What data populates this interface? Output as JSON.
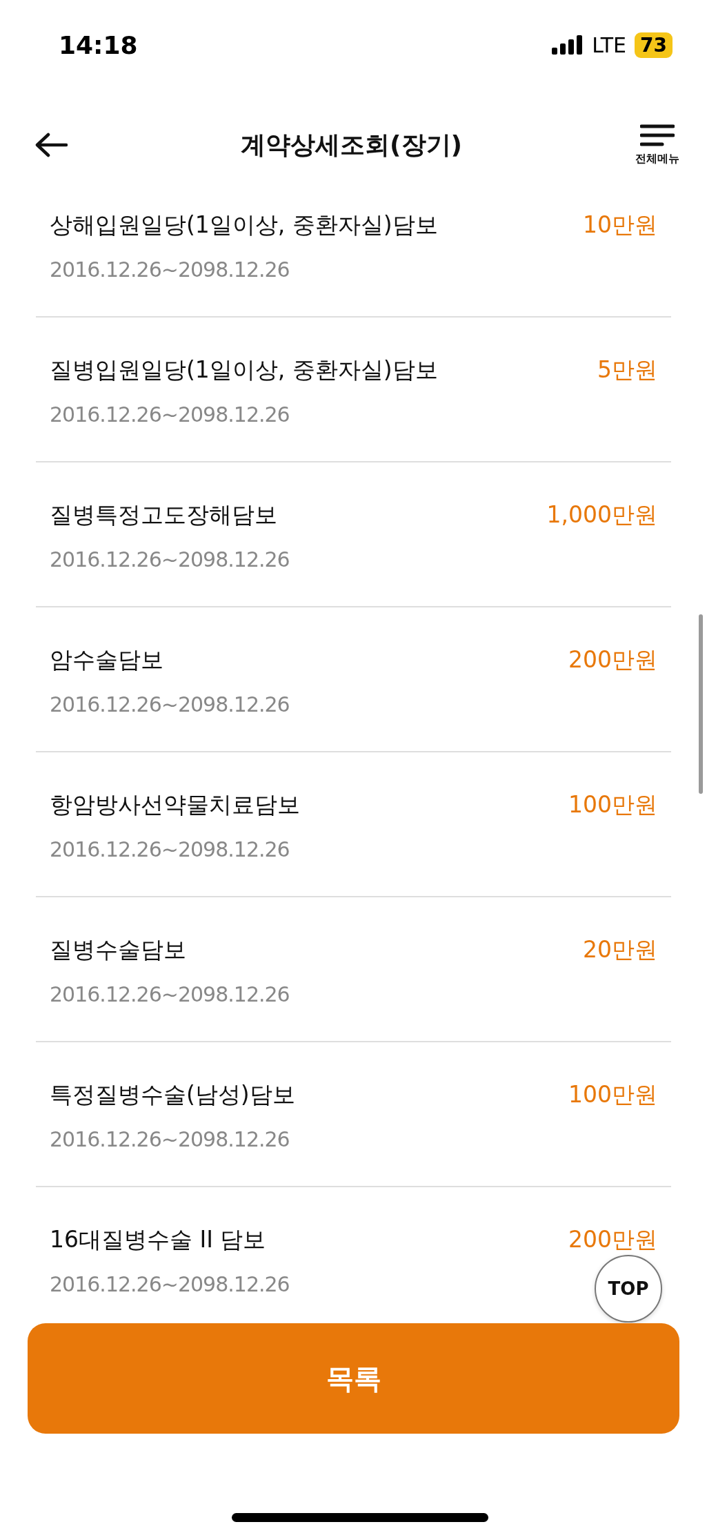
{
  "status_bar": {
    "time": "14:18",
    "network": "LTE",
    "battery": "73"
  },
  "header": {
    "title": "계약상세조회(장기)",
    "menu_label": "전체메뉴"
  },
  "coverages": [
    {
      "name": "상해입원일당(1일이상, 중환자실)담보",
      "period": "2016.12.26~2098.12.26",
      "amount": "10만원"
    },
    {
      "name": "질병입원일당(1일이상, 중환자실)담보",
      "period": "2016.12.26~2098.12.26",
      "amount": "5만원"
    },
    {
      "name": "질병특정고도장해담보",
      "period": "2016.12.26~2098.12.26",
      "amount": "1,000만원"
    },
    {
      "name": "암수술담보",
      "period": "2016.12.26~2098.12.26",
      "amount": "200만원"
    },
    {
      "name": "항암방사선약물치료담보",
      "period": "2016.12.26~2098.12.26",
      "amount": "100만원"
    },
    {
      "name": "질병수술담보",
      "period": "2016.12.26~2098.12.26",
      "amount": "20만원"
    },
    {
      "name": "특정질병수술(남성)담보",
      "period": "2016.12.26~2098.12.26",
      "amount": "100만원"
    },
    {
      "name": "16대질병수술 II 담보",
      "period": "2016.12.26~2098.12.26",
      "amount": "200만원"
    }
  ],
  "top_button": "TOP",
  "list_button": "목록"
}
